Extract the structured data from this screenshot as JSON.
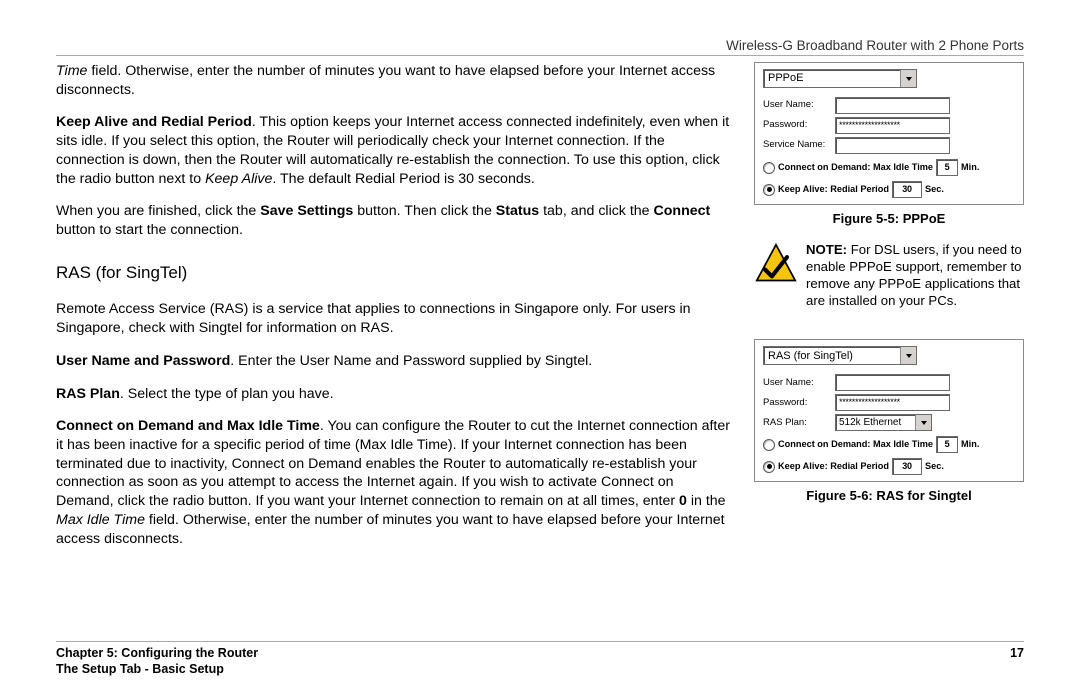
{
  "header": "Wireless-G Broadband Router with 2 Phone Ports",
  "body": {
    "p1a": "Time",
    "p1b": " field. Otherwise, enter the number of minutes you want to have elapsed before your Internet access disconnects.",
    "p2a": "Keep Alive and Redial Period",
    "p2b": ". This option keeps your Internet access connected indefinitely, even when it sits idle. If you select this option, the Router will periodically check your Internet connection. If the connection is down, then the Router will automatically re-establish the connection. To use this option, click the radio button next to ",
    "p2c": "Keep Alive",
    "p2d": ". The default Redial Period is 30 seconds.",
    "p3a": "When you are finished, click the ",
    "p3b": "Save Settings",
    "p3c": " button. Then click the ",
    "p3d": "Status",
    "p3e": " tab, and click the ",
    "p3f": "Connect",
    "p3g": " button to start the connection.",
    "h_ras": "RAS (for SingTel)",
    "p4": "Remote Access Service (RAS) is a service that applies to connections in Singapore only. For users in Singapore, check with Singtel for information on RAS.",
    "p5a": "User Name and Password",
    "p5b": ". Enter the User Name and Password supplied by Singtel.",
    "p6a": "RAS Plan",
    "p6b": ". Select the type of plan you have.",
    "p7a": "Connect on Demand and Max Idle Time",
    "p7b": ". You can configure the Router to cut the Internet connection after it has been inactive for a specific period of time (Max Idle Time). If your Internet connection has been terminated due to inactivity, Connect on Demand enables the Router to automatically re-establish your connection as soon as you attempt to access the Internet again. If you wish to activate Connect on Demand, click the radio button. If you want your Internet connection to remain on at all times, enter ",
    "p7c": "0",
    "p7d": " in the ",
    "p7e": "Max Idle Time",
    "p7f": " field. Otherwise, enter the number of minutes you want to have elapsed before your Internet access disconnects."
  },
  "fig1": {
    "select": "PPPoE",
    "labels": {
      "un": "User Name:",
      "pw": "Password:",
      "sn": "Service Name:"
    },
    "pwmask": "*******************",
    "r1": "Connect on Demand: Max Idle Time",
    "r1val": "5",
    "r1unit": "Min.",
    "r2": "Keep Alive: Redial Period",
    "r2val": "30",
    "r2unit": "Sec.",
    "caption": "Figure 5-5: PPPoE"
  },
  "note": {
    "prefix": "NOTE:",
    "text": "  For DSL users, if you need to enable PPPoE support, remember to remove any PPPoE applications that are installed on your PCs."
  },
  "fig2": {
    "select": "RAS (for SingTel)",
    "labels": {
      "un": "User Name:",
      "pw": "Password:",
      "rp": "RAS Plan:"
    },
    "pwmask": "*******************",
    "plan": "512k Ethernet",
    "r1": "Connect on Demand: Max Idle Time",
    "r1val": "5",
    "r1unit": "Min.",
    "r2": "Keep Alive: Redial Period",
    "r2val": "30",
    "r2unit": "Sec.",
    "caption": "Figure 5-6: RAS for Singtel"
  },
  "footer": {
    "chapter": "Chapter 5: Configuring the Router",
    "sub": "The Setup Tab - Basic Setup",
    "page": "17"
  }
}
